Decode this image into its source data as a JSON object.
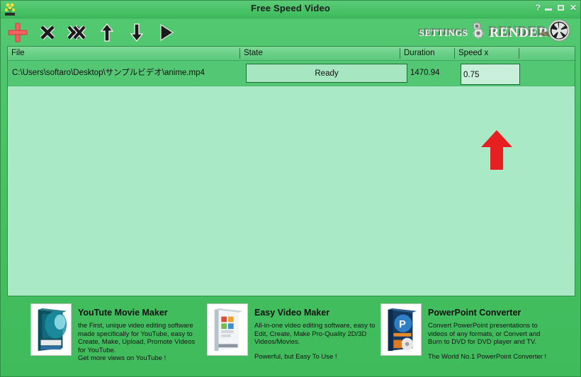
{
  "window": {
    "title": "Free Speed Video",
    "icon": "app-logo-icon",
    "controls": {
      "help": "?",
      "minimize": "–",
      "maximize": "□",
      "close": "✕"
    }
  },
  "toolbar": {
    "buttons": [
      {
        "name": "add-file-button",
        "label": "Add",
        "icon": "plus-icon"
      },
      {
        "name": "remove-file-button",
        "label": "Remove",
        "icon": "x-icon"
      },
      {
        "name": "remove-all-files-button",
        "label": "Remove All",
        "icon": "double-x-icon"
      },
      {
        "name": "move-up-button",
        "label": "Move Up",
        "icon": "arrow-up-icon"
      },
      {
        "name": "move-down-button",
        "label": "Move Down",
        "icon": "arrow-down-icon"
      },
      {
        "name": "play-button",
        "label": "Play",
        "icon": "play-icon"
      }
    ],
    "settings_label": "SETTINGS",
    "render_label": "RENDER"
  },
  "file_list": {
    "columns": [
      "File",
      "State",
      "Duration",
      "Speed x"
    ],
    "rows": [
      {
        "file": "C:\\Users\\softaro\\Desktop\\サンプルビデオ\\anime.mp4",
        "state": "Ready",
        "duration": "1470.94",
        "speed": "0.75"
      }
    ]
  },
  "annotation": {
    "type": "red-up-arrow",
    "color": "#e81f21",
    "points_to": "speed-x-input"
  },
  "ads": [
    {
      "title": "YouTute Movie Maker",
      "desc": "the First, unique video editing software\nmade specifically for YouTube, easy to\nCreate, Make, Upload, Promote Videos\nfor YouTube.\nGet more views on YouTube !",
      "tag": ""
    },
    {
      "title": "Easy Video Maker",
      "desc": "All-in-one video editing software, easy to\nEdit, Create, Make Pro-Quality 2D/3D\nVideos/Movies.",
      "tag": "Powerful, but Easy To Use !"
    },
    {
      "title": "PowerPoint Converter",
      "desc": "Convert PowerPoint presentations to\nvideos of any formats, or Convert and\nBurn to DVD for DVD player and TV.",
      "tag": "The World No.1 PowerPoint Converter !"
    }
  ],
  "colors": {
    "window_green": "#46bf63",
    "header_green": "#6bd189",
    "list_body": "#a9e9c5",
    "row_green": "#54c774",
    "annotation_red": "#e81f21"
  }
}
